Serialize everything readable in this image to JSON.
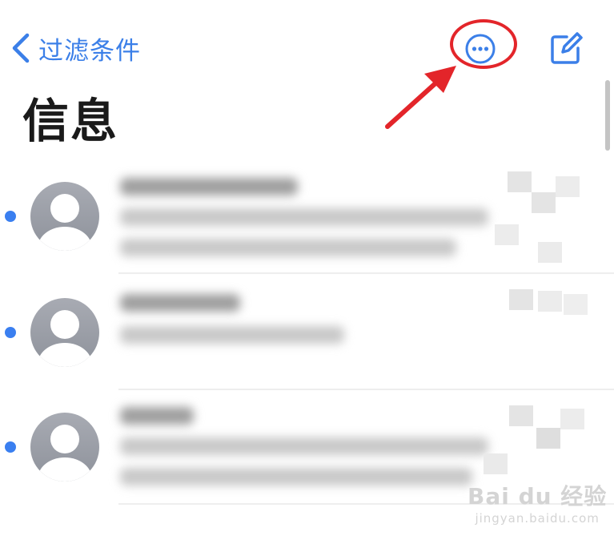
{
  "nav": {
    "back_label": "过滤条件",
    "more_icon": "ellipsis-circle-icon",
    "compose_icon": "compose-icon"
  },
  "page": {
    "title": "信息"
  },
  "colors": {
    "accent": "#3b7fe8",
    "annotation": "#e3252a",
    "unread": "#3a7ff0"
  },
  "messages": [
    {
      "unread": true,
      "avatar_icon": "contact-placeholder-icon",
      "content": "blurred"
    },
    {
      "unread": true,
      "avatar_icon": "contact-placeholder-icon",
      "content": "blurred"
    },
    {
      "unread": true,
      "avatar_icon": "contact-placeholder-icon",
      "content": "blurred"
    }
  ],
  "watermark": {
    "logo": "Bai du 经验",
    "url": "jingyan.baidu.com"
  }
}
